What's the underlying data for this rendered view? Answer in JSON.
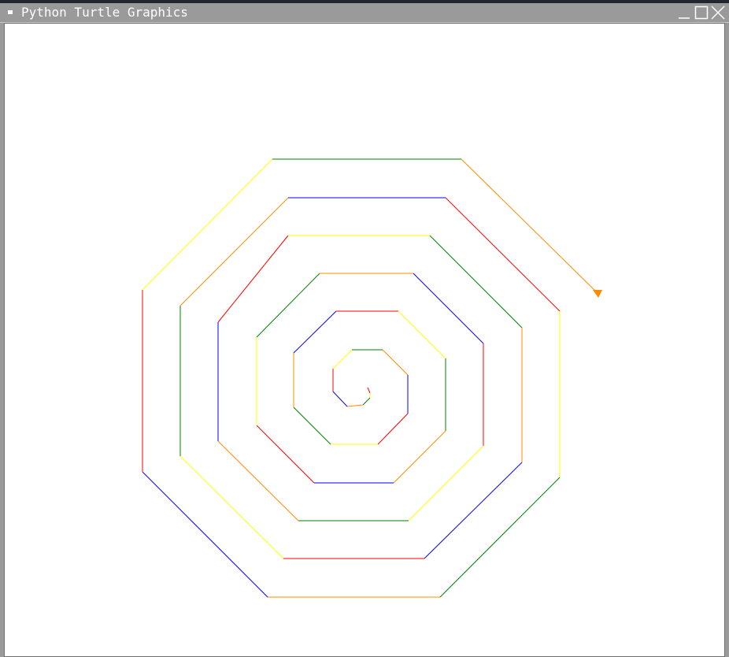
{
  "window": {
    "title": "Python Turtle Graphics",
    "menu_icon": "window-menu-icon",
    "controls": [
      {
        "name": "minimize-button",
        "icon": "minimize-icon"
      },
      {
        "name": "maximize-button",
        "icon": "maximize-icon"
      },
      {
        "name": "close-button",
        "icon": "close-icon"
      }
    ]
  },
  "canvas": {
    "background": "#ffffff",
    "drawing": "octagonal spiral of colored line segments",
    "turtle_cursor_color": "#ff8c00",
    "palette": [
      "#ff0000",
      "#ff8c00",
      "#ffff00",
      "#008000",
      "#0000ff"
    ]
  }
}
